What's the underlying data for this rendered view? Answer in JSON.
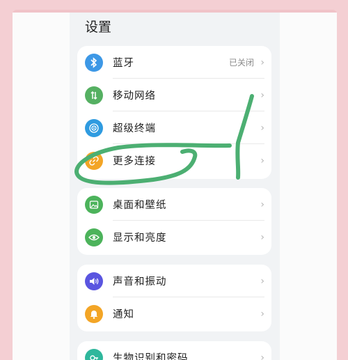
{
  "screen_title": "设置",
  "colors": {
    "background": "#f4cfd3",
    "bluetooth": "#3d98e6",
    "mobile_network": "#55b062",
    "super_device": "#2f9be0",
    "more_connections": "#f3a526",
    "desktop_wallpaper": "#4cb35b",
    "display_brightness": "#4cb35b",
    "sounds_vibration": "#5a55e0",
    "notifications": "#f3a526",
    "biometrics": "#2fb79c",
    "annotation": "#4caf72"
  },
  "groups": [
    {
      "items": [
        {
          "label": "蓝牙",
          "value": "已关闭",
          "icon": "bluetooth-icon"
        },
        {
          "label": "移动网络",
          "value": "",
          "icon": "mobile-network-icon"
        },
        {
          "label": "超级终端",
          "value": "",
          "icon": "super-device-icon"
        },
        {
          "label": "更多连接",
          "value": "",
          "icon": "link-icon"
        }
      ]
    },
    {
      "items": [
        {
          "label": "桌面和壁纸",
          "value": "",
          "icon": "wallpaper-icon"
        },
        {
          "label": "显示和亮度",
          "value": "",
          "icon": "eye-icon"
        }
      ]
    },
    {
      "items": [
        {
          "label": "声音和振动",
          "value": "",
          "icon": "speaker-icon"
        },
        {
          "label": "通知",
          "value": "",
          "icon": "bell-icon"
        }
      ]
    },
    {
      "items": [
        {
          "label": "生物识别和密码",
          "value": "",
          "icon": "key-icon"
        }
      ]
    }
  ]
}
